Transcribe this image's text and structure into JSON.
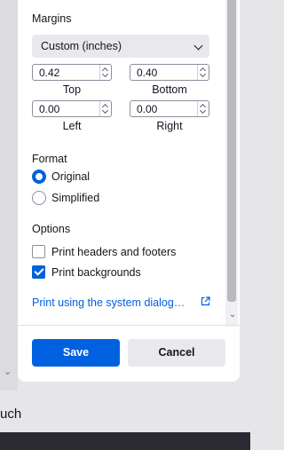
{
  "background": {
    "partial_text": "uch"
  },
  "margins": {
    "label": "Margins",
    "preset": "Custom (inches)",
    "top": {
      "label": "Top",
      "value": "0.42"
    },
    "bottom": {
      "label": "Bottom",
      "value": "0.40"
    },
    "left": {
      "label": "Left",
      "value": "0.00"
    },
    "right": {
      "label": "Right",
      "value": "0.00"
    }
  },
  "format": {
    "label": "Format",
    "options": [
      {
        "label": "Original",
        "selected": true
      },
      {
        "label": "Simplified",
        "selected": false
      }
    ]
  },
  "options": {
    "label": "Options",
    "items": [
      {
        "label": "Print headers and footers",
        "checked": false
      },
      {
        "label": "Print backgrounds",
        "checked": true
      }
    ]
  },
  "system_dialog_link": "Print using the system dialog…",
  "buttons": {
    "save": "Save",
    "cancel": "Cancel"
  },
  "colors": {
    "accent": "#0061e0",
    "secondary_button": "#e9e9ed"
  }
}
